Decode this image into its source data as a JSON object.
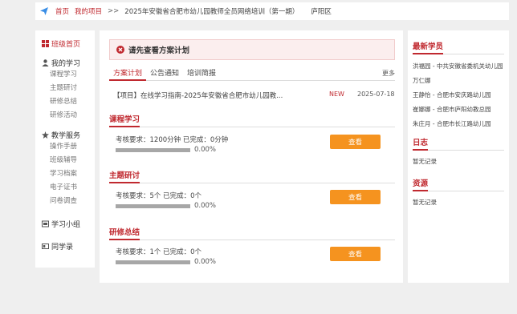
{
  "topbar": {
    "home": "首页",
    "project": "我的项目",
    "sep": ">>",
    "current": "2025年安徽省合肥市幼儿园教师全员网络培训（第一期）",
    "region": "庐阳区"
  },
  "sidebar": {
    "class_home": "班级首页",
    "my_study": {
      "title": "我的学习",
      "items": [
        "课程学习",
        "主题研讨",
        "研修总结",
        "研修活动"
      ]
    },
    "teaching": {
      "title": "教学服务",
      "items": [
        "操作手册",
        "班级辅导",
        "学习档案",
        "电子证书",
        "问卷调查"
      ]
    },
    "group": "学习小组",
    "classmates": "同学录"
  },
  "main": {
    "notice": "请先查看方案计划",
    "tabs": [
      "方案计划",
      "公告通知",
      "培训简报"
    ],
    "more": "更多",
    "news": {
      "title": "【项目】在线学习指南-2025年安徽省合肥市幼儿园教...",
      "badge": "NEW",
      "date": "2025-07-18"
    },
    "sections": [
      {
        "title": "课程学习",
        "requirement": "考核要求：1200分钟 已完成：0分钟",
        "progress": 0,
        "percent": "0.00%",
        "button": "查看"
      },
      {
        "title": "主题研讨",
        "requirement": "考核要求：5个 已完成：0个",
        "progress": 0,
        "percent": "0.00%",
        "button": "查看"
      },
      {
        "title": "研修总结",
        "requirement": "考核要求：1个 已完成：0个",
        "progress": 0,
        "percent": "0.00%",
        "button": "查看"
      }
    ]
  },
  "right": {
    "students_title": "最新学员",
    "students": [
      "洪福园 - 中共安徽省委机关幼儿园",
      "万仁娜",
      "王静怡 - 合肥市安庆路幼儿园",
      "崔娜娜 - 合肥市庐阳幼教总园",
      "朱庄月 - 合肥市长江路幼儿园"
    ],
    "log_title": "日志",
    "log_empty": "暂无记录",
    "resource_title": "资源",
    "resource_empty": "暂无记录"
  },
  "colors": {
    "accent": "#c0292f",
    "button": "#f5931f",
    "bg": "#efefef"
  }
}
